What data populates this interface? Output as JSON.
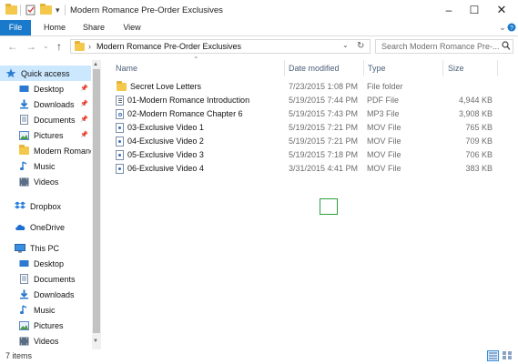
{
  "window": {
    "title": "Modern Romance Pre-Order Exclusives",
    "minimize_icon": "minimize-icon",
    "maximize_icon": "maximize-icon",
    "close_icon": "close-icon"
  },
  "ribbon": {
    "tabs": [
      {
        "label": "File",
        "active": true
      },
      {
        "label": "Home"
      },
      {
        "label": "Share"
      },
      {
        "label": "View"
      }
    ],
    "accent_color": "#1979ca"
  },
  "address": {
    "path_segment": "Modern Romance Pre-Order Exclusives",
    "separator": "›",
    "search_placeholder": "Search Modern Romance Pre-..."
  },
  "nav_pane": {
    "quick_access": {
      "label": "Quick access",
      "items": [
        {
          "label": "Desktop",
          "pinned": true,
          "icon": "desktop-icon"
        },
        {
          "label": "Downloads",
          "pinned": true,
          "icon": "downloads-icon"
        },
        {
          "label": "Documents",
          "pinned": true,
          "icon": "documents-icon"
        },
        {
          "label": "Pictures",
          "pinned": true,
          "icon": "pictures-icon"
        },
        {
          "label": "Modern Romance",
          "pinned": false,
          "icon": "folder-icon"
        },
        {
          "label": "Music",
          "pinned": false,
          "icon": "music-icon"
        },
        {
          "label": "Videos",
          "pinned": false,
          "icon": "videos-icon"
        }
      ]
    },
    "dropbox": {
      "label": "Dropbox"
    },
    "onedrive": {
      "label": "OneDrive"
    },
    "this_pc": {
      "label": "This PC",
      "items": [
        {
          "label": "Desktop",
          "icon": "desktop-icon"
        },
        {
          "label": "Documents",
          "icon": "documents-icon"
        },
        {
          "label": "Downloads",
          "icon": "downloads-icon"
        },
        {
          "label": "Music",
          "icon": "music-icon"
        },
        {
          "label": "Pictures",
          "icon": "pictures-icon"
        },
        {
          "label": "Videos",
          "icon": "videos-icon"
        }
      ]
    }
  },
  "file_list": {
    "columns": {
      "name": "Name",
      "date": "Date modified",
      "type": "Type",
      "size": "Size"
    },
    "rows": [
      {
        "name": "Secret Love Letters",
        "date": "7/23/2015 1:08 PM",
        "type": "File folder",
        "size": "",
        "icon": "folder"
      },
      {
        "name": "01-Modern Romance Introduction",
        "date": "5/19/2015 7:44 PM",
        "type": "PDF File",
        "size": "4,944 KB",
        "icon": "pdf"
      },
      {
        "name": "02-Modern Romance Chapter 6",
        "date": "5/19/2015 7:43 PM",
        "type": "MP3 File",
        "size": "3,908 KB",
        "icon": "audio"
      },
      {
        "name": "03-Exclusive Video 1",
        "date": "5/19/2015 7:21 PM",
        "type": "MOV File",
        "size": "765 KB",
        "icon": "video"
      },
      {
        "name": "04-Exclusive Video 2",
        "date": "5/19/2015 7:21 PM",
        "type": "MOV File",
        "size": "709 KB",
        "icon": "video"
      },
      {
        "name": "05-Exclusive Video 3",
        "date": "5/19/2015 7:18 PM",
        "type": "MOV File",
        "size": "706 KB",
        "icon": "video"
      },
      {
        "name": "06-Exclusive Video 4",
        "date": "3/31/2015 4:41 PM",
        "type": "MOV File",
        "size": "383 KB",
        "icon": "video"
      }
    ]
  },
  "status": {
    "item_count": "7 items"
  }
}
